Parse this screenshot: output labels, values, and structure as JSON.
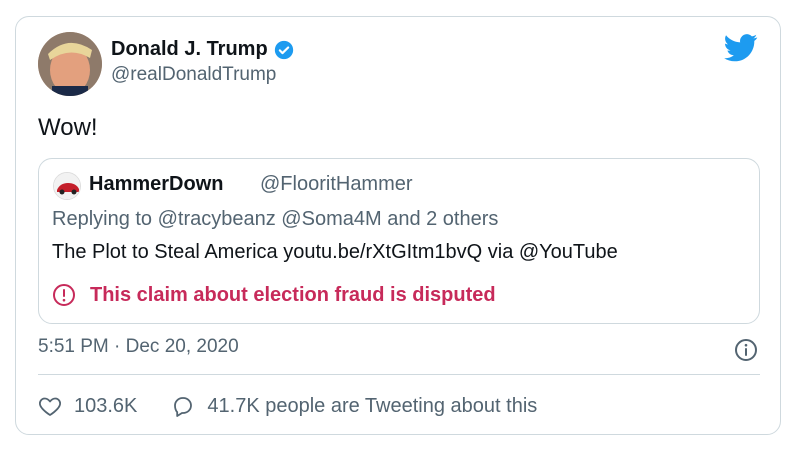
{
  "tweet": {
    "name": "Donald J. Trump",
    "handle": "@realDonaldTrump",
    "text": "Wow!",
    "time": "5:51 PM · Dec 20, 2020"
  },
  "quoted": {
    "name": "HammerDown",
    "handle": "@FlooritHammer",
    "replying": "Replying to @tracybeanz @Soma4M and 2 others",
    "text": "The Plot to Steal America youtu.be/rXtGItm1bvQ via @YouTube",
    "warning": "This claim about election fraud is disputed"
  },
  "actions": {
    "likes": "103.6K",
    "tweeting": "41.7K people are Tweeting about this"
  },
  "colors": {
    "verified": "#1d9bf0",
    "warning": "#c72a5a",
    "twitter": "#1d9bf0"
  },
  "icons": [
    "verified-badge-icon",
    "twitter-bird-icon",
    "info-icon",
    "heart-icon",
    "comment-icon",
    "warning-icon"
  ]
}
